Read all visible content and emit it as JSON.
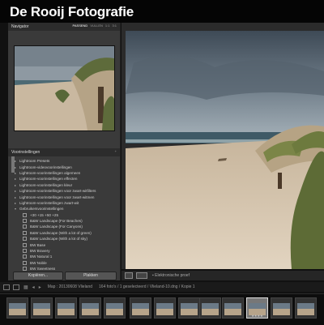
{
  "app": {
    "title": "De Rooij Fotografie"
  },
  "navigator": {
    "label": "Navigator",
    "view_options": [
      "PASSEND",
      "VULLEN",
      "1:1",
      "3:1"
    ],
    "selected_option": "PASSEND"
  },
  "presets": {
    "label": "Voorinstellingen",
    "items": [
      "Lightroom Presets",
      "Lightroom-videovoorinstellingen",
      "Lightroom-voorinstellingen algemeen",
      "Lightroom-voorinstellingen effecten",
      "Lightroom-voorinstellingen kleur",
      "Lightroom-voorinstellingen voor zwart-witfilters",
      "Lightroom-voorinstellingen voor zwart-witmen",
      "Lightroom-voorinstellingen zwart-wit",
      "Gebruikersvoorinstellingen"
    ],
    "user_items": [
      "+30 +15 +50 +25",
      "B&W Landscape (For Beaches)",
      "B&W Landscape (For Canyons)",
      "B&W Landscape (With a lot of green)",
      "B&W Landscape (With a lot of sky)",
      "BW Base",
      "BW Bravery",
      "BW Natural 1",
      "BW Noble",
      "BW Sweetness"
    ]
  },
  "buttons": {
    "import": "Kopiëren...",
    "paste": "Plakken"
  },
  "toolbar": {
    "soft_proof_label": "Elektronische proef"
  },
  "status": {
    "folder_path": "Map : 20130608 Vlieland",
    "info": "164 foto's / 1 geselecteerd / Vlieland-10.dng / Kopie 1"
  },
  "filmstrip": {
    "count": 13,
    "selected_index": 10,
    "selected_stars": "★★★★"
  },
  "colors": {
    "accent": "#dddddd",
    "panel_bg": "#3a3a3a",
    "app_bg": "#111111"
  }
}
